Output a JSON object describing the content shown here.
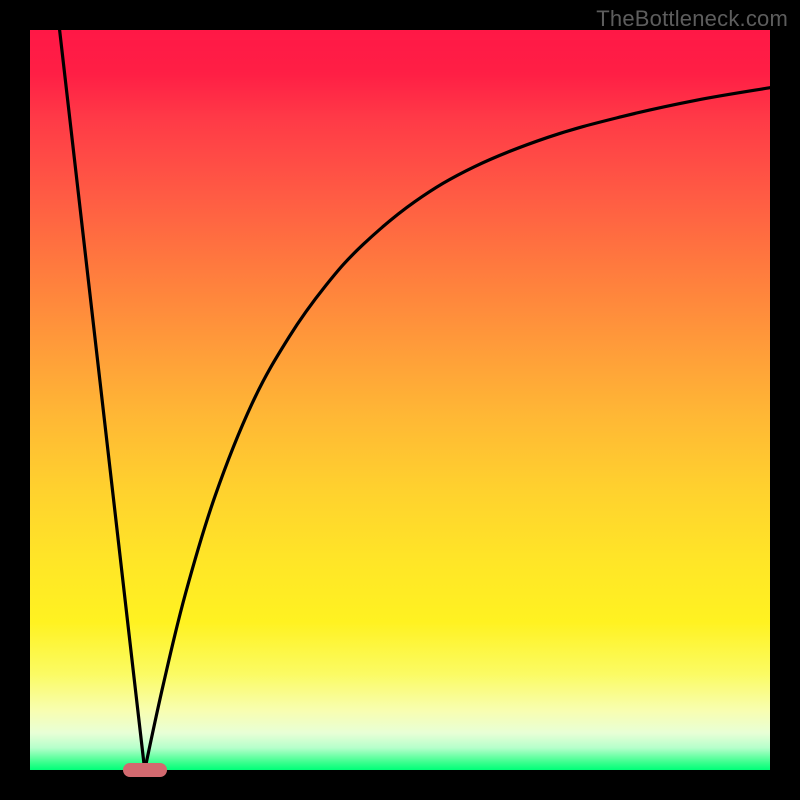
{
  "watermark": "TheBottleneck.com",
  "chart_data": {
    "type": "line",
    "title": "",
    "xlabel": "",
    "ylabel": "",
    "xlim": [
      0,
      1
    ],
    "ylim": [
      0,
      1
    ],
    "legend": false,
    "grid": false,
    "background": "rainbow-gradient-red-top-green-bottom",
    "marker": {
      "x": 0.155,
      "y": 0.0,
      "shape": "rounded-bar",
      "color": "#d2696f"
    },
    "series": [
      {
        "name": "left-branch",
        "x": [
          0.04,
          0.06,
          0.08,
          0.1,
          0.12,
          0.14,
          0.155
        ],
        "values": [
          1.0,
          0.826,
          0.652,
          0.478,
          0.304,
          0.13,
          0.0
        ]
      },
      {
        "name": "right-branch",
        "x": [
          0.155,
          0.18,
          0.21,
          0.25,
          0.3,
          0.35,
          0.4,
          0.45,
          0.52,
          0.6,
          0.7,
          0.8,
          0.9,
          1.0
        ],
        "values": [
          0.0,
          0.115,
          0.238,
          0.37,
          0.495,
          0.585,
          0.655,
          0.71,
          0.768,
          0.815,
          0.855,
          0.883,
          0.905,
          0.922
        ]
      }
    ]
  }
}
